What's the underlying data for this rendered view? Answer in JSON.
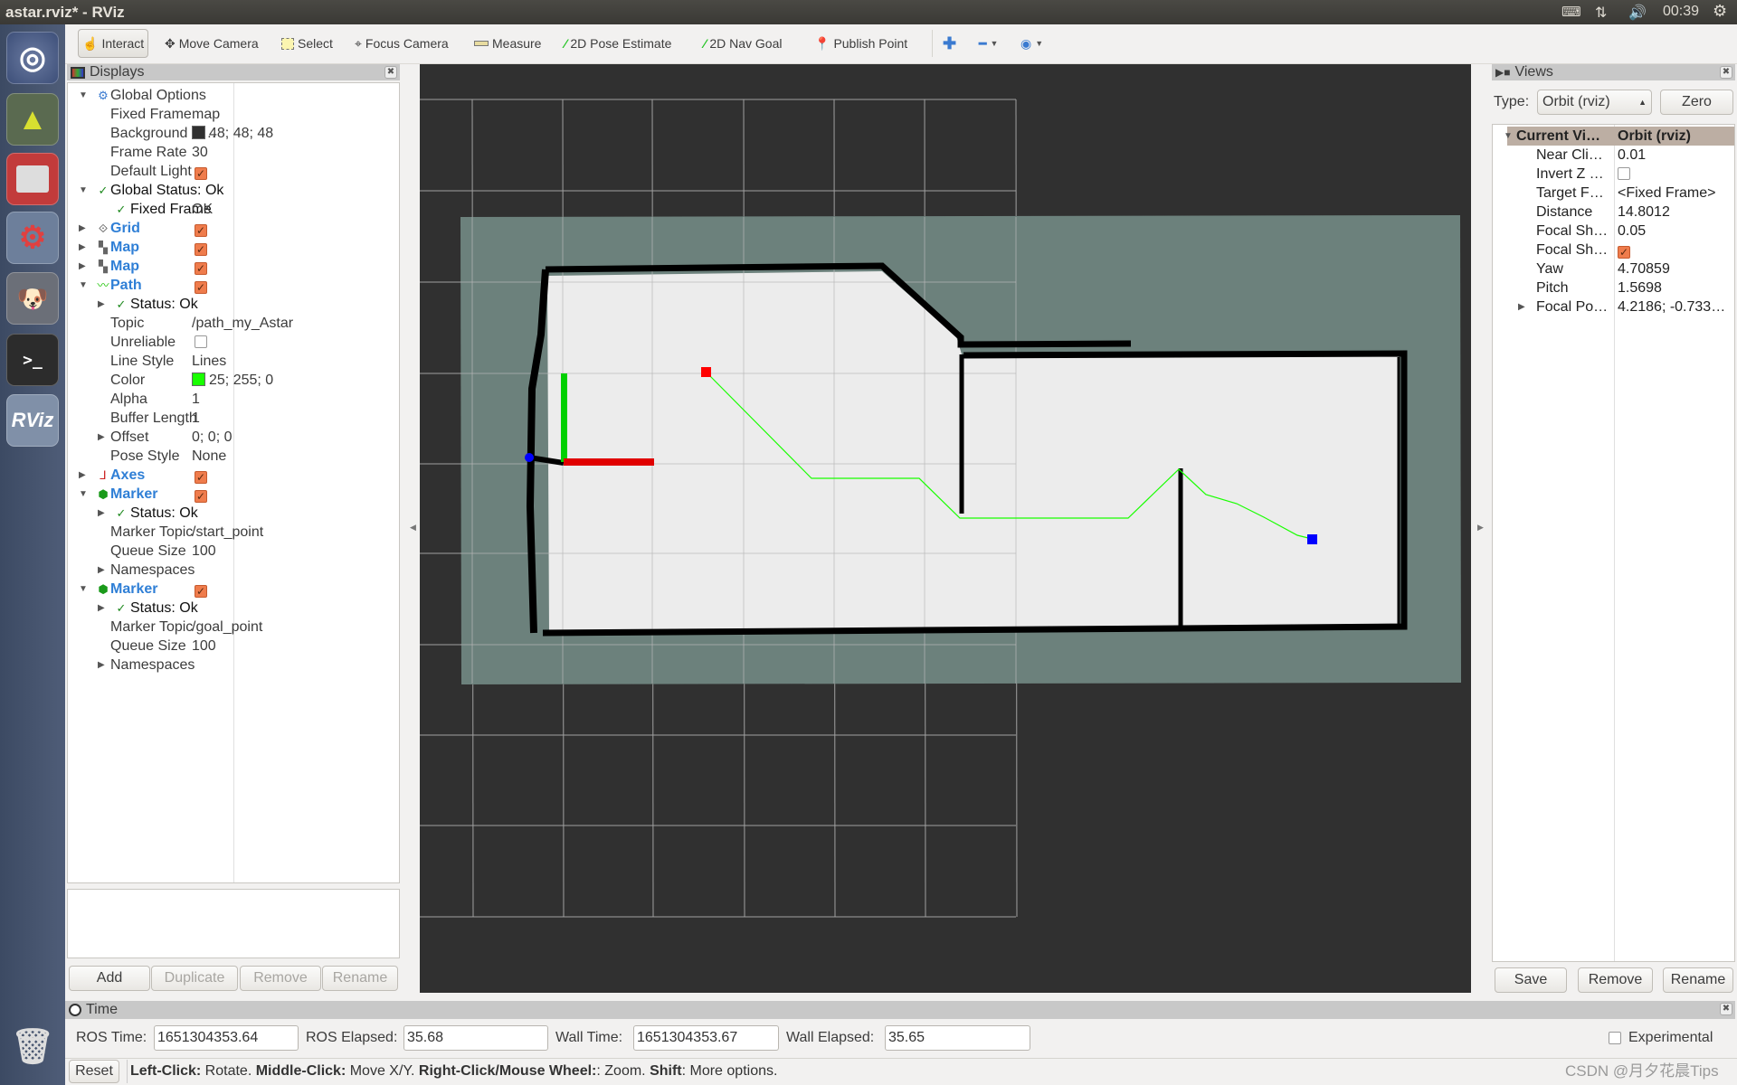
{
  "window": {
    "title": "astar.rviz* - RViz"
  },
  "tray": {
    "clock": "00:39",
    "icons": [
      "keyboard-icon",
      "network-icon",
      "volume-icon",
      "power-gear-icon"
    ]
  },
  "launcher": {
    "items": [
      "ubuntu-dash",
      "unity-tweak",
      "files",
      "system-settings",
      "gimp",
      "terminal",
      "rviz",
      "trash"
    ],
    "rviz_label": "RViz"
  },
  "toolbar": {
    "tools": [
      {
        "label": "Interact",
        "icon": "hand-icon",
        "active": true
      },
      {
        "label": "Move Camera",
        "icon": "move-camera-icon"
      },
      {
        "label": "Select",
        "icon": "select-icon"
      },
      {
        "label": "Focus Camera",
        "icon": "focus-camera-icon"
      },
      {
        "label": "Measure",
        "icon": "ruler-icon"
      },
      {
        "label": "2D Pose Estimate",
        "icon": "green-arrow-icon"
      },
      {
        "label": "2D Nav Goal",
        "icon": "green-arrow-icon"
      },
      {
        "label": "Publish Point",
        "icon": "map-pin-icon"
      }
    ]
  },
  "displays": {
    "title": "Displays",
    "rows": [
      {
        "kind": "group",
        "exp": "open",
        "icon": "gear",
        "label": "Global Options"
      },
      {
        "kind": "prop",
        "label": "Fixed Frame",
        "value": "map"
      },
      {
        "kind": "prop",
        "label": "Background C…",
        "value": "48; 48; 48",
        "swatch": "#303030"
      },
      {
        "kind": "prop",
        "label": "Frame Rate",
        "value": "30"
      },
      {
        "kind": "prop",
        "label": "Default Light",
        "check": true
      },
      {
        "kind": "gstatus",
        "exp": "open",
        "label": "Global Status: Ok"
      },
      {
        "kind": "status",
        "label": "Fixed Frame",
        "value": "OK"
      },
      {
        "kind": "display",
        "exp": "closed",
        "icon": "grid",
        "label": "Grid",
        "check": true
      },
      {
        "kind": "display",
        "exp": "closed",
        "icon": "map",
        "label": "Map",
        "check": true
      },
      {
        "kind": "display",
        "exp": "closed",
        "icon": "map",
        "label": "Map",
        "check": true
      },
      {
        "kind": "display",
        "exp": "open",
        "icon": "path",
        "label": "Path",
        "check": true
      },
      {
        "kind": "status",
        "exp": "closed",
        "label": "Status: Ok"
      },
      {
        "kind": "prop",
        "label": "Topic",
        "value": "/path_my_Astar"
      },
      {
        "kind": "prop",
        "label": "Unreliable",
        "check": false
      },
      {
        "kind": "prop",
        "label": "Line Style",
        "value": "Lines"
      },
      {
        "kind": "prop",
        "label": "Color",
        "value": "25; 255; 0",
        "swatch": "#19ff00"
      },
      {
        "kind": "prop",
        "label": "Alpha",
        "value": "1"
      },
      {
        "kind": "prop",
        "label": "Buffer Length",
        "value": "1"
      },
      {
        "kind": "prop",
        "exp": "closed",
        "label": "Offset",
        "value": "0; 0; 0"
      },
      {
        "kind": "prop",
        "label": "Pose Style",
        "value": "None"
      },
      {
        "kind": "display",
        "exp": "closed",
        "icon": "axes",
        "label": "Axes",
        "check": true
      },
      {
        "kind": "display",
        "exp": "open",
        "icon": "marker",
        "label": "Marker",
        "check": true
      },
      {
        "kind": "status",
        "exp": "closed",
        "label": "Status: Ok"
      },
      {
        "kind": "prop",
        "label": "Marker Topic",
        "value": "/start_point"
      },
      {
        "kind": "prop",
        "label": "Queue Size",
        "value": "100"
      },
      {
        "kind": "prop",
        "exp": "closed",
        "label": "Namespaces"
      },
      {
        "kind": "display",
        "exp": "open",
        "icon": "marker",
        "label": "Marker",
        "check": true
      },
      {
        "kind": "status",
        "exp": "closed",
        "label": "Status: Ok"
      },
      {
        "kind": "prop",
        "label": "Marker Topic",
        "value": "/goal_point"
      },
      {
        "kind": "prop",
        "label": "Queue Size",
        "value": "100"
      },
      {
        "kind": "prop",
        "exp": "closed",
        "label": "Namespaces"
      }
    ],
    "buttons": [
      {
        "label": "Add",
        "enabled": true
      },
      {
        "label": "Duplicate",
        "enabled": false
      },
      {
        "label": "Remove",
        "enabled": false
      },
      {
        "label": "Rename",
        "enabled": false
      }
    ]
  },
  "views": {
    "title": "Views",
    "type_label": "Type:",
    "type_value": "Orbit (rviz)",
    "zero_label": "Zero",
    "header": {
      "label": "Current Vi…",
      "value": "Orbit (rviz)"
    },
    "rows": [
      {
        "label": "Near Cli…",
        "value": "0.01"
      },
      {
        "label": "Invert Z …",
        "check": false
      },
      {
        "label": "Target F…",
        "value": "<Fixed Frame>"
      },
      {
        "label": "Distance",
        "value": "14.8012"
      },
      {
        "label": "Focal Sh…",
        "value": "0.05"
      },
      {
        "label": "Focal Sh…",
        "check": true
      },
      {
        "label": "Yaw",
        "value": "4.70859"
      },
      {
        "label": "Pitch",
        "value": "1.5698"
      },
      {
        "label": "Focal Po…",
        "value": "4.2186; -0.733…",
        "exp": "closed"
      }
    ],
    "buttons": [
      "Save",
      "Remove",
      "Rename"
    ]
  },
  "time": {
    "title": "Time",
    "ros_time_label": "ROS Time:",
    "ros_time": "1651304353.64",
    "ros_elapsed_label": "ROS Elapsed:",
    "ros_elapsed": "35.68",
    "wall_time_label": "Wall Time:",
    "wall_time": "1651304353.67",
    "wall_elapsed_label": "Wall Elapsed:",
    "wall_elapsed": "35.65",
    "experimental_label": "Experimental",
    "experimental": false
  },
  "status": {
    "reset_label": "Reset",
    "hints": [
      {
        "b": "Left-Click:",
        "t": " Rotate. "
      },
      {
        "b": "Middle-Click:",
        "t": " Move X/Y. "
      },
      {
        "b": "Right-Click/Mouse Wheel:",
        "t": ": Zoom. "
      },
      {
        "b": "Shift",
        "t": ": More options."
      }
    ]
  },
  "watermark": "CSDN @月夕花晨Tips",
  "viewport": {
    "background": "#303030",
    "path_color": "#19ff00",
    "start_marker_color": "#ff0000",
    "goal_marker_color": "#0000ff"
  }
}
